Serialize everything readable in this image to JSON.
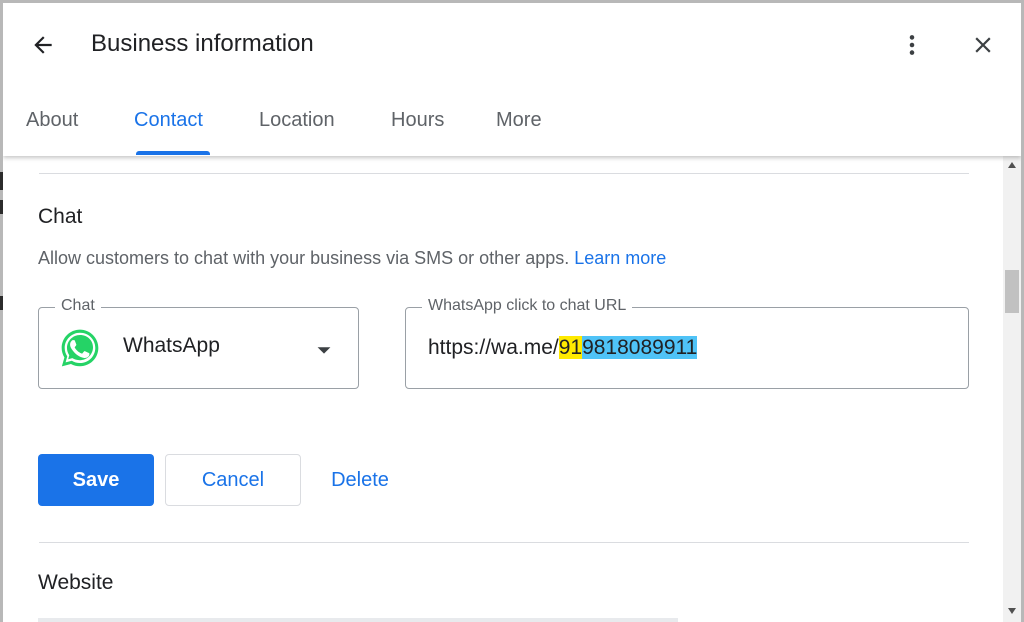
{
  "header": {
    "title": "Business information",
    "back_icon": "arrow-left-icon",
    "more_icon": "more-vert-icon",
    "close_icon": "close-icon"
  },
  "tabs": [
    {
      "label": "About",
      "active": false
    },
    {
      "label": "Contact",
      "active": true
    },
    {
      "label": "Location",
      "active": false
    },
    {
      "label": "Hours",
      "active": false
    },
    {
      "label": "More",
      "active": false
    }
  ],
  "chat": {
    "section_title": "Chat",
    "description": "Allow customers to chat with your business via SMS or other apps.",
    "learn_more": "Learn more",
    "chat_field": {
      "label": "Chat",
      "value": "WhatsApp",
      "icon": "whatsapp-icon"
    },
    "url_field": {
      "label": "WhatsApp click to chat URL",
      "prefix": "https://wa.me/",
      "country_code": "91",
      "number": "9818089911"
    },
    "save_label": "Save",
    "cancel_label": "Cancel",
    "delete_label": "Delete"
  },
  "website": {
    "section_title": "Website"
  },
  "colors": {
    "accent": "#1a73e8",
    "highlight_country_code": "#ffea00",
    "highlight_number": "#4fc3f7",
    "whatsapp_green": "#25d366"
  }
}
